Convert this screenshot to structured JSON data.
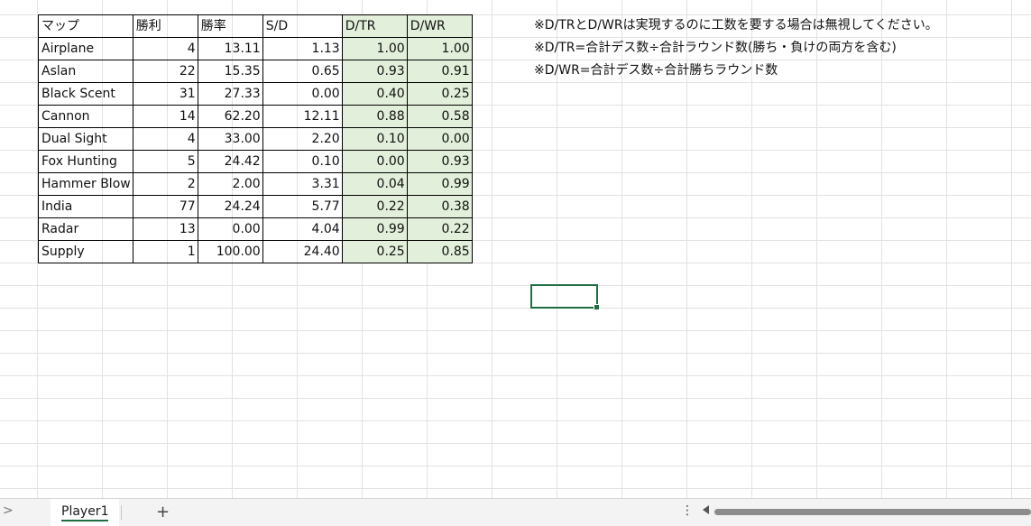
{
  "table": {
    "headers": [
      "マップ",
      "勝利",
      "勝率",
      "S/D",
      "D/TR",
      "D/WR"
    ],
    "rows": [
      [
        "Airplane",
        "4",
        "13.11",
        "1.13",
        "1.00",
        "1.00"
      ],
      [
        "Aslan",
        "22",
        "15.35",
        "0.65",
        "0.93",
        "0.91"
      ],
      [
        "Black Scent",
        "31",
        "27.33",
        "0.00",
        "0.40",
        "0.25"
      ],
      [
        "Cannon",
        "14",
        "62.20",
        "12.11",
        "0.88",
        "0.58"
      ],
      [
        "Dual Sight",
        "4",
        "33.00",
        "2.20",
        "0.10",
        "0.00"
      ],
      [
        "Fox Hunting",
        "5",
        "24.42",
        "0.10",
        "0.00",
        "0.93"
      ],
      [
        "Hammer Blow",
        "2",
        "2.00",
        "3.31",
        "0.04",
        "0.99"
      ],
      [
        "India",
        "77",
        "24.24",
        "5.77",
        "0.22",
        "0.38"
      ],
      [
        "Radar",
        "13",
        "0.00",
        "4.04",
        "0.99",
        "0.22"
      ],
      [
        "Supply",
        "1",
        "100.00",
        "24.40",
        "0.25",
        "0.85"
      ]
    ]
  },
  "notes": [
    "※D/TRとD/WRは実現するのに工数を要する場合は無視してください。",
    "※D/TR=合計デス数÷合計ラウンド数(勝ち・負けの両方を含む)",
    "※D/WR=合計デス数÷合計勝ちラウンド数"
  ],
  "tabbar": {
    "sheet_tab": "Player1",
    "add_sheet": "+",
    "nav_arrow": ">",
    "more": "⋮"
  },
  "colors": {
    "highlight_fill": "#e2efda",
    "selection_border": "#1f6e43"
  },
  "icons": {
    "add_sheet": "plus-icon",
    "more": "vertical-ellipsis-icon",
    "nav": "chevron-right-icon",
    "scroll": "triangle-left-icon"
  }
}
